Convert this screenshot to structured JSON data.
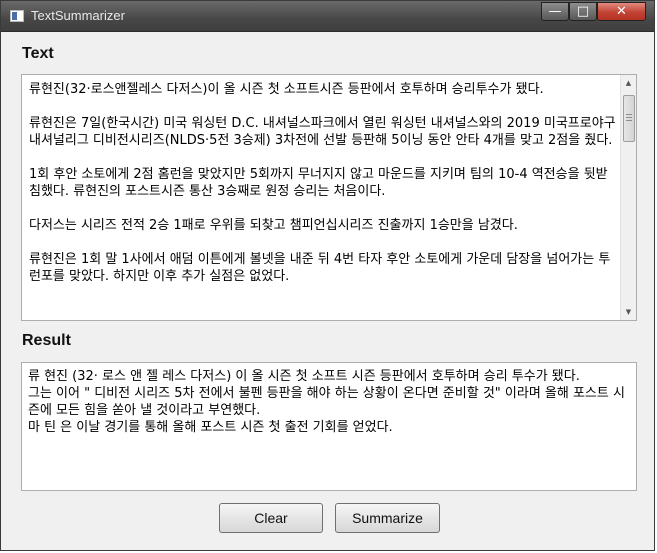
{
  "window": {
    "title": "TextSummarizer",
    "controls": {
      "minimize": "—",
      "maximize": "□",
      "close": "✕"
    }
  },
  "text_section": {
    "label": "Text",
    "paragraphs": [
      "류현진(32·로스앤젤레스 다저스)이 올 시즌 첫 소프트시즌 등판에서 호투하며 승리투수가 됐다.",
      "류현진은 7일(한국시간) 미국 워싱턴 D.C. 내셔널스파크에서 열린 워싱턴 내셔널스와의 2019 미국프로야구 내셔널리그 디비전시리즈(NLDS·5전 3승제) 3차전에 선발 등판해 5이닝 동안 안타 4개를 맞고 2점을 줬다.",
      "1회 후안 소토에게 2점 홈런을 맞았지만 5회까지 무너지지 않고 마운드를 지키며 팀의 10-4 역전승을 뒷받침했다. 류현진의 포스트시즌 통산 3승째로 원정 승리는 처음이다.",
      "다저스는 시리즈 전적 2승 1패로 우위를 되찾고 챔피언십시리즈 진출까지 1승만을 남겼다.",
      "류현진은 1회 말 1사에서 애덤 이튼에게 볼넷을 내준 뒤 4번 타자 후안 소토에게 가운데 담장을 넘어가는 투런포를 맞았다. 하지만 이후 추가 실점은 없었다."
    ],
    "scroll_up_icon": "▲",
    "scroll_down_icon": "▼"
  },
  "result_section": {
    "label": "Result",
    "lines": [
      "류 현진 (32· 로스 앤 젤 레스 다저스) 이 올 시즌 첫 소프트 시즌 등판에서 호투하며 승리 투수가 됐다.",
      "그는 이어 \" 디비전 시리즈 5차 전에서 불펜 등판을 해야 하는 상황이 온다면 준비할 것\" 이라며 올해 포스트 시즌에 모든 힘을 쏟아 낼 것이라고 부연했다.",
      "마 틴 은 이날 경기를 통해 올해 포스트 시즌 첫 출전 기회를 얻었다."
    ]
  },
  "buttons": {
    "clear": "Clear",
    "summarize": "Summarize"
  }
}
